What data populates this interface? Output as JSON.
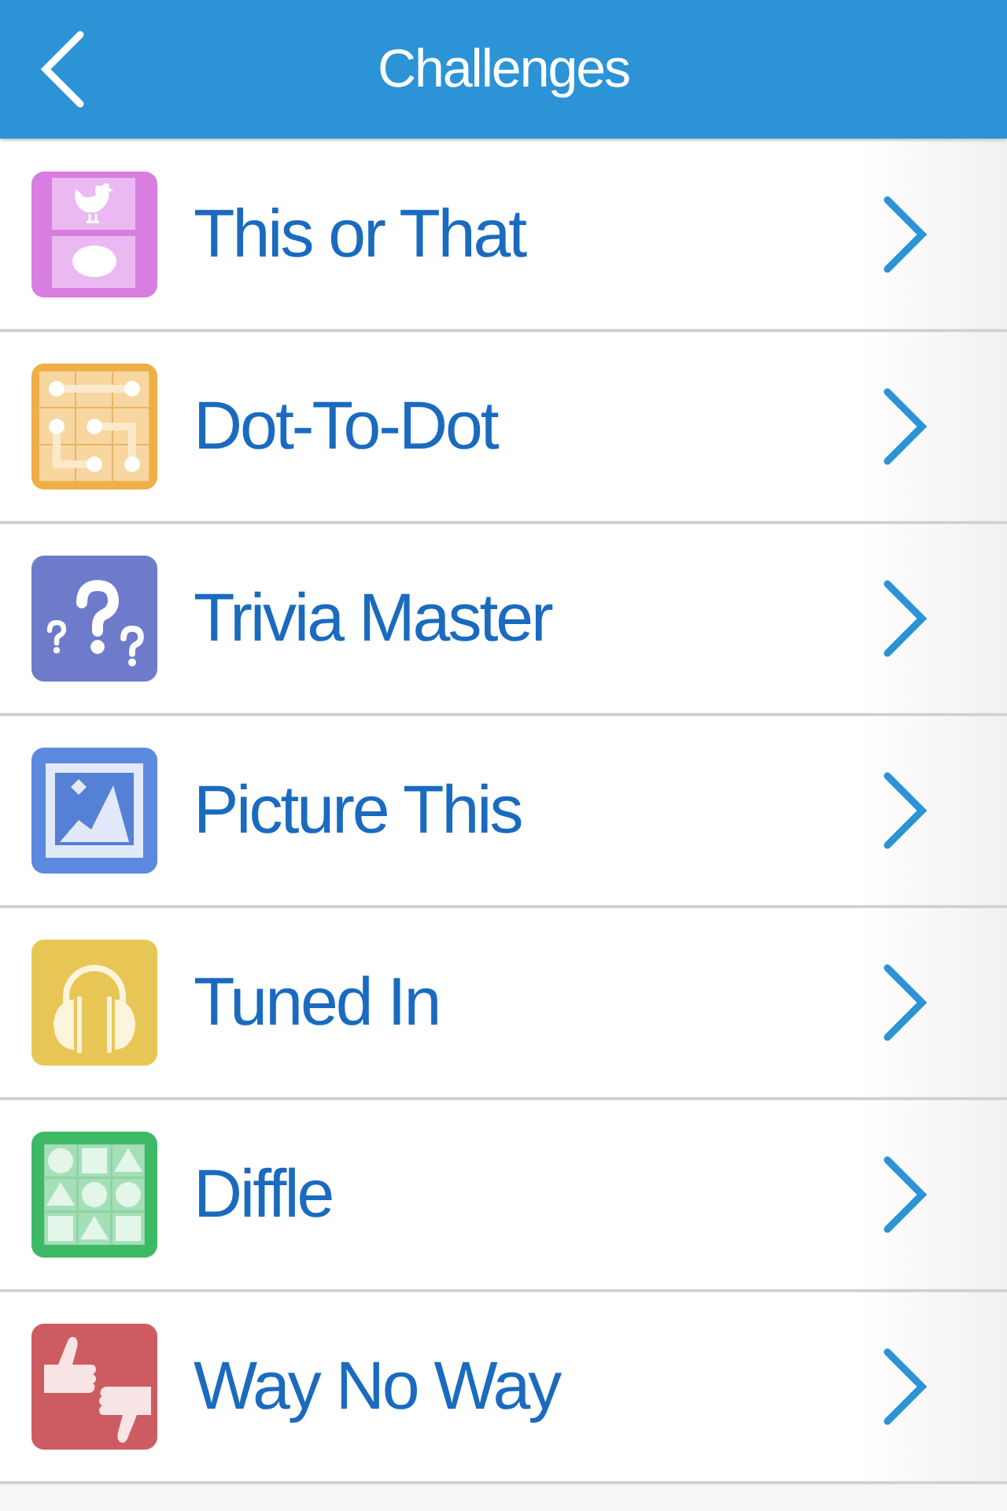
{
  "header": {
    "title": "Challenges"
  },
  "items": [
    {
      "label": "This or That",
      "kind": "split",
      "color": "#d77ee0"
    },
    {
      "label": "Dot-To-Dot",
      "kind": "dots",
      "color": "#f0ae47"
    },
    {
      "label": "Trivia Master",
      "kind": "questions",
      "color": "#6e7bcb"
    },
    {
      "label": "Picture This",
      "kind": "picture",
      "color": "#5b8ae0"
    },
    {
      "label": "Tuned In",
      "kind": "headphones",
      "color": "#e8c656"
    },
    {
      "label": "Diffle",
      "kind": "shapes",
      "color": "#3db966"
    },
    {
      "label": "Way No Way",
      "kind": "thumbs",
      "color": "#cd5c62"
    }
  ]
}
